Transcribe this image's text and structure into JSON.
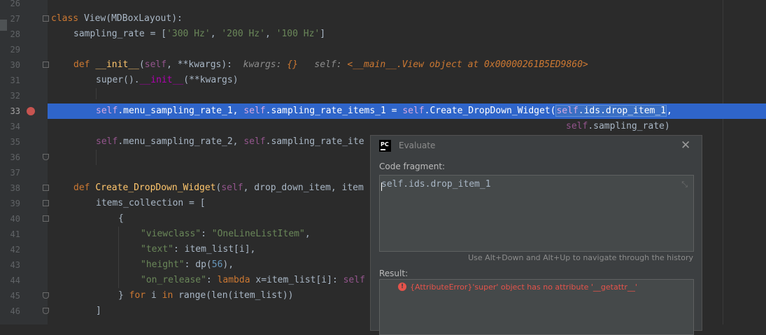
{
  "colors": {
    "editor_bg": "#2b2b2b",
    "gutter_bg": "#313335",
    "current_line": "#2f65ca",
    "keyword": "#cc7832",
    "self": "#94558d",
    "function": "#ffc66d",
    "string": "#6a8759",
    "number": "#6897bb",
    "breakpoint": "#c75450",
    "error": "#e5534b",
    "dialog_bg": "#3c3f41"
  },
  "editor": {
    "line_numbers": [
      "26",
      "27",
      "28",
      "29",
      "30",
      "31",
      "32",
      "33",
      "34",
      "35",
      "36",
      "37",
      "38",
      "39",
      "40",
      "41",
      "42",
      "43",
      "44",
      "45",
      "46"
    ],
    "current_line": "33",
    "breakpoint_line": "33",
    "code": {
      "l27": {
        "class": "class",
        "rest": " View(MDBoxLayout):"
      },
      "l28": {
        "name": "sampling_rate = [",
        "s1": "'300 Hz'",
        "c1": ", ",
        "s2": "'200 Hz'",
        "c2": ", ",
        "s3": "'100 Hz'",
        "end": "]"
      },
      "l30": {
        "def": "def",
        "fn": "__init__",
        "p1": "(",
        "self": "self",
        "p2": ", **kwargs):",
        "hint1": "kwargs: ",
        "hint1v": "{}",
        "hint2": "self: ",
        "hint2v": "<__main__.View object at 0x00000261B5ED9860>"
      },
      "l31": {
        "a": "super().",
        "b": "__init__",
        "c": "(**kwargs)"
      },
      "l33": {
        "self1": "self",
        "a": ".menu_sampling_rate_1, ",
        "self2": "self",
        "b": ".sampling_rate_items_1 = ",
        "self3": "self",
        "c": ".Create_DropDown_Widget(",
        "self4": "self",
        "d": ".ids.drop_item_1",
        "e": ","
      },
      "l34": {
        "self": "self",
        "a": ".sampling_rate)"
      },
      "l35": {
        "self1": "self",
        "a": ".menu_sampling_rate_2, ",
        "self2": "self",
        "b": ".sampling_rate_ite"
      },
      "l38": {
        "def": "def",
        "fn": "Create_DropDown_Widget",
        "a": "(",
        "self": "self",
        "b": ", drop_down_item, item"
      },
      "l39": {
        "a": "items_collection = ["
      },
      "l40": {
        "a": "{"
      },
      "l41": {
        "k": "\"viewclass\"",
        "c": ": ",
        "v": "\"OneLineListItem\"",
        "e": ","
      },
      "l42": {
        "k": "\"text\"",
        "c": ": item_list[i],"
      },
      "l43": {
        "k": "\"height\"",
        "c": ": dp(",
        "n": "56",
        "e": "),"
      },
      "l44": {
        "k": "\"on_release\"",
        "c": ": ",
        "lam": "lambda",
        "d": " x=item_list[i]: ",
        "self": "self"
      },
      "l45": {
        "a": "} ",
        "for": "for",
        "b": " i ",
        "in": "in",
        "c": " range(len(item_list))"
      },
      "l46": {
        "a": "]"
      }
    }
  },
  "evaluate_dialog": {
    "title": "Evaluate",
    "code_fragment_label": "Code fragment:",
    "code_fragment_value": "self.ids.drop_item_1",
    "history_hint": "Use Alt+Down and Alt+Up to navigate through the history",
    "result_label": "Result:",
    "result_error": "{AttributeError}'super' object has no attribute '__getattr__'",
    "icons": [
      "pycharm-icon",
      "close-icon",
      "expand-icon",
      "error-icon"
    ]
  }
}
